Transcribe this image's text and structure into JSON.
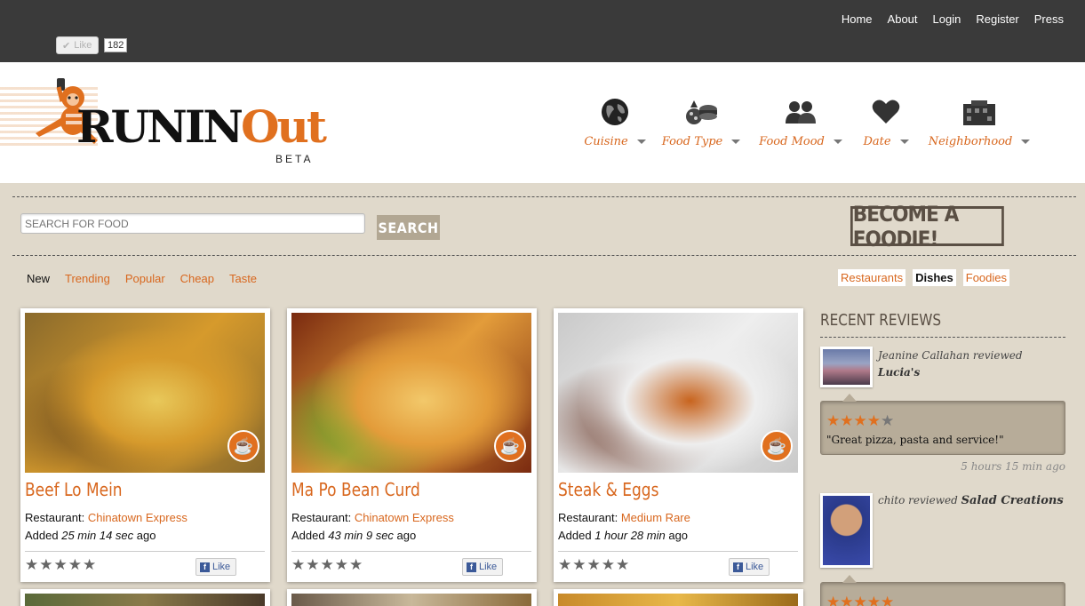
{
  "topnav": [
    "Home",
    "About",
    "Login",
    "Register",
    "Press"
  ],
  "fb_top": {
    "label": "Like",
    "count": "182"
  },
  "logo": {
    "main": "RUNIN",
    "accent": "Out",
    "beta": "BETA"
  },
  "categories": [
    {
      "label": "Cuisine",
      "icon": "globe-icon"
    },
    {
      "label": "Food Type",
      "icon": "food-type-icon"
    },
    {
      "label": "Food Mood",
      "icon": "people-icon"
    },
    {
      "label": "Date",
      "icon": "heart-icon"
    },
    {
      "label": "Neighborhood",
      "icon": "buildings-icon"
    }
  ],
  "search": {
    "placeholder": "SEARCH FOR FOOD",
    "button": "SEARCH"
  },
  "foodie_button": "BECOME A FOODIE!",
  "filters": [
    "New",
    "Trending",
    "Popular",
    "Cheap",
    "Taste"
  ],
  "active_filter": "New",
  "toggles": [
    "Restaurants",
    "Dishes",
    "Foodies"
  ],
  "active_toggle": "Dishes",
  "restaurant_label": "Restaurant:",
  "added_label": "Added",
  "ago_label": "ago",
  "like_label": "Like",
  "dishes": [
    {
      "title": "Beef Lo Mein",
      "restaurant": "Chinatown Express",
      "added": "25 min 14 sec",
      "rating": 0,
      "photo_colors": [
        "#8a6a2c",
        "#d69a2c",
        "#e8c85a",
        "#6b4a1e"
      ]
    },
    {
      "title": "Ma Po Bean Curd",
      "restaurant": "Chinatown Express",
      "added": "43 min 9 sec",
      "rating": 0,
      "photo_colors": [
        "#7a2a10",
        "#e39c3a",
        "#f2c86a",
        "#5aa82a"
      ]
    },
    {
      "title": "Steak & Eggs",
      "restaurant": "Medium Rare",
      "added": "1 hour 28 min",
      "rating": 0,
      "photo_colors": [
        "#c9c9c9",
        "#eeeeee",
        "#c8641e",
        "#6b3a2a"
      ]
    }
  ],
  "sidebar": {
    "title": "RECENT REVIEWS",
    "reviews": [
      {
        "user": "Jeanine Callahan",
        "verb": "reviewed",
        "place": "Lucia's",
        "rating": 4,
        "quote": "\"Great pizza, pasta and service!\"",
        "time": "5 hours 15 min ago"
      },
      {
        "user": "chito",
        "verb": "reviewed",
        "place": "Salad Creations",
        "rating": 5
      }
    ]
  },
  "colors": {
    "accent": "#d8671e",
    "topbar": "#3a3a3a",
    "background": "#e0d9cb"
  }
}
